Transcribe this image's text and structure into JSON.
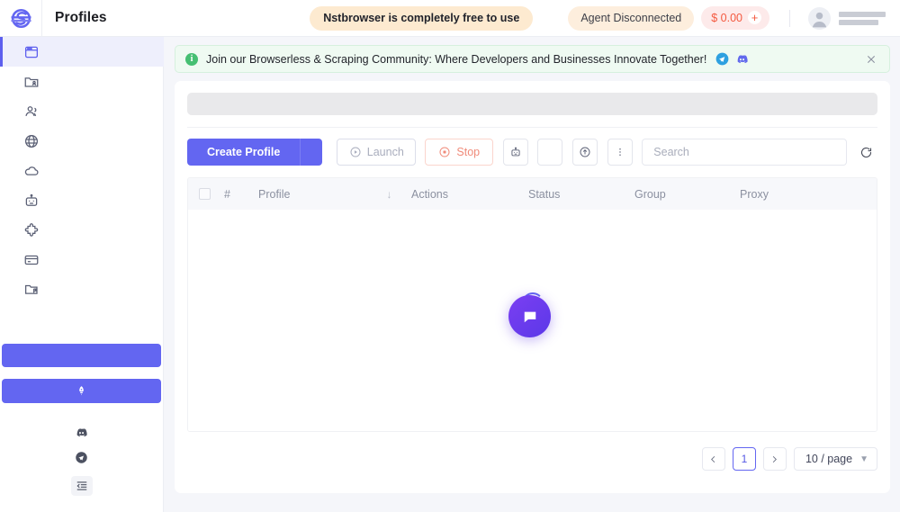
{
  "header": {
    "logo_icon": "nstbrowser-logo-icon",
    "title": "Profiles",
    "free_pill": "Nstbrowser is completely free to use",
    "agent_status": "Agent Disconnected",
    "balance": "$ 0.00",
    "balance_add": "+",
    "avatar_icon": "user-avatar-icon",
    "username": ""
  },
  "sidebar": {
    "items": [
      {
        "name": "sidebar-item-profiles",
        "icon": "browser-window-icon",
        "active": true
      },
      {
        "name": "sidebar-item-groups",
        "icon": "folder-user-icon",
        "active": false
      },
      {
        "name": "sidebar-item-team",
        "icon": "users-icon",
        "active": false
      },
      {
        "name": "sidebar-item-proxies",
        "icon": "globe-icon",
        "active": false
      },
      {
        "name": "sidebar-item-cloud",
        "icon": "cloud-icon",
        "active": false
      },
      {
        "name": "sidebar-item-automation",
        "icon": "robot-icon",
        "active": false
      },
      {
        "name": "sidebar-item-extensions",
        "icon": "puzzle-icon",
        "active": false
      },
      {
        "name": "sidebar-item-billing",
        "icon": "credit-card-icon",
        "active": false
      },
      {
        "name": "sidebar-item-transfer",
        "icon": "folder-flag-icon",
        "active": false
      }
    ],
    "promo_primary_label": "",
    "promo_secondary_icon": "rocket-icon",
    "social": [
      {
        "name": "discord-icon",
        "label": ""
      },
      {
        "name": "telegram-icon",
        "label": ""
      }
    ],
    "collapse_icon": "collapse-sidebar-icon"
  },
  "banner": {
    "info_icon": "info-icon",
    "text": "Join our Browserless & Scraping Community: Where Developers and Businesses Innovate Together!",
    "icons": [
      {
        "name": "telegram-icon"
      },
      {
        "name": "discord-icon"
      }
    ],
    "close_icon": "close-icon"
  },
  "toolbar": {
    "create_profile_label": "Create Profile",
    "create_profile_caret_icon": "chevron-down-icon",
    "launch_label": "Launch",
    "launch_icon": "play-circle-icon",
    "stop_label": "Stop",
    "stop_icon": "stop-circle-icon",
    "robot_icon": "robot-icon",
    "blank_icon": "",
    "upload_icon": "upload-circle-icon",
    "more_icon": "more-vertical-icon",
    "search_placeholder": "Search",
    "search_value": "",
    "refresh_icon": "refresh-icon"
  },
  "table": {
    "columns": [
      {
        "key": "checkbox",
        "label": ""
      },
      {
        "key": "num",
        "label": "#"
      },
      {
        "key": "profile",
        "label": "Profile",
        "sort_icon": "sort-desc-arrow"
      },
      {
        "key": "actions",
        "label": "Actions"
      },
      {
        "key": "status",
        "label": "Status"
      },
      {
        "key": "group",
        "label": "Group"
      },
      {
        "key": "proxy",
        "label": "Proxy"
      }
    ],
    "rows": [],
    "loading": true,
    "loading_icon": "loading-spinner"
  },
  "chat_widget": {
    "icon": "chat-bubble-icon"
  },
  "pagination": {
    "prev_icon": "chevron-left-icon",
    "current_page": "1",
    "next_icon": "chevron-right-icon",
    "page_size": "10 / page",
    "page_size_caret": "chevron-down-icon"
  },
  "colors": {
    "accent": "#6366f1",
    "banner_bg": "#effaf2",
    "free_pill_bg": "#fdead0",
    "balance_text": "#f4593f"
  }
}
